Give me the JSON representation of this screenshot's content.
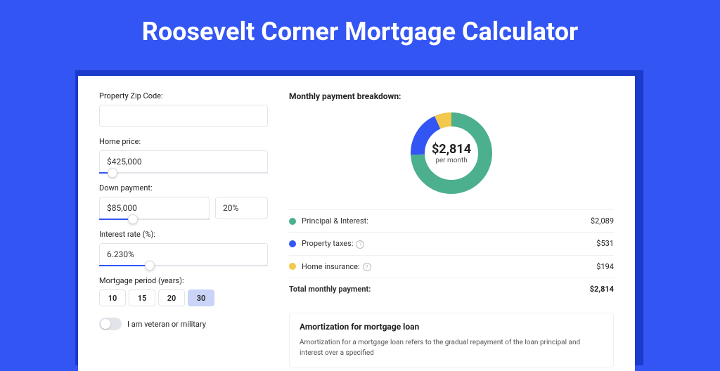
{
  "title": "Roosevelt Corner Mortgage Calculator",
  "form": {
    "zip_label": "Property Zip Code:",
    "zip_value": "",
    "home_price_label": "Home price:",
    "home_price_value": "$425,000",
    "down_payment_label": "Down payment:",
    "down_payment_value": "$85,000",
    "down_payment_pct": "20%",
    "interest_label": "Interest rate (%):",
    "interest_value": "6.230%",
    "period_label": "Mortgage period (years):",
    "periods": [
      "10",
      "15",
      "20",
      "30"
    ],
    "period_active": "30",
    "veteran_label": "I am veteran or military"
  },
  "breakdown": {
    "heading": "Monthly payment breakdown:",
    "total_display": "$2,814",
    "per_month": "per month",
    "items": [
      {
        "label": "Principal & Interest:",
        "value": "$2,089",
        "color": "#4caf8e"
      },
      {
        "label": "Property taxes:",
        "value": "$531",
        "color": "#3355f3",
        "help": true
      },
      {
        "label": "Home insurance:",
        "value": "$194",
        "color": "#f3c84c",
        "help": true
      }
    ],
    "total_label": "Total monthly payment:",
    "total_value": "$2,814"
  },
  "amort": {
    "heading": "Amortization for mortgage loan",
    "text": "Amortization for a mortgage loan refers to the gradual repayment of the loan principal and interest over a specified"
  },
  "chart_data": {
    "type": "pie",
    "title": "Monthly payment breakdown",
    "series": [
      {
        "name": "Principal & Interest",
        "value": 2089,
        "color": "#4caf8e"
      },
      {
        "name": "Property taxes",
        "value": 531,
        "color": "#3355f3"
      },
      {
        "name": "Home insurance",
        "value": 194,
        "color": "#f3c84c"
      }
    ],
    "total": 2814
  }
}
